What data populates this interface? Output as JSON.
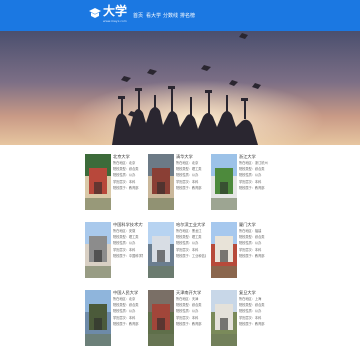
{
  "header": {
    "logo_text": "大学",
    "logo_sub": "www.meyx.com",
    "nav": [
      "首页",
      "看大学",
      "分数线",
      "排名榜"
    ]
  },
  "cards": [
    {
      "name": "北京大学",
      "rows": [
        "所在地区：北京",
        "院校类型：综合类",
        "院校性质：公办",
        "学历层次：本科",
        "院校属于：教育部"
      ]
    },
    {
      "name": "清华大学",
      "rows": [
        "所在地区：北京",
        "院校类型：理工类",
        "院校性质：公办",
        "学历层次：本科",
        "院校属于：教育部"
      ]
    },
    {
      "name": "浙江大学",
      "rows": [
        "所在地区：浙江杭州",
        "院校类型：综合类",
        "院校性质：公办",
        "学历层次：本科",
        "院校属于：教育部"
      ]
    },
    {
      "name": "中国科学技术大学（科…）",
      "rows": [
        "所在地区：安徽",
        "院校类型：理工类",
        "院校性质：公办",
        "学历层次：本科",
        "院校属于：中国科学院"
      ]
    },
    {
      "name": "哈尔滨工业大学",
      "rows": [
        "所在地区：黑龙江",
        "院校类型：理工类",
        "院校性质：公办",
        "学历层次：本科",
        "院校属于：工业和信息"
      ]
    },
    {
      "name": "厦门大学",
      "rows": [
        "所在地区：福建",
        "院校类型：综合类",
        "院校性质：公办",
        "学历层次：本科",
        "院校属于：教育部"
      ]
    },
    {
      "name": "中国人民大学",
      "rows": [
        "所在地区：北京",
        "院校类型：综合类",
        "院校性质：公办",
        "学历层次：本科",
        "院校属于：教育部"
      ]
    },
    {
      "name": "天津南开大学",
      "rows": [
        "所在地区：天津",
        "院校类型：综合类",
        "院校性质：公办",
        "学历层次：本科",
        "院校属于：教育部"
      ]
    },
    {
      "name": "复旦大学",
      "rows": [
        "所在地区：上海",
        "院校类型：综合类",
        "院校性质：公办",
        "学历层次：本科",
        "院校属于：教育部"
      ]
    }
  ]
}
